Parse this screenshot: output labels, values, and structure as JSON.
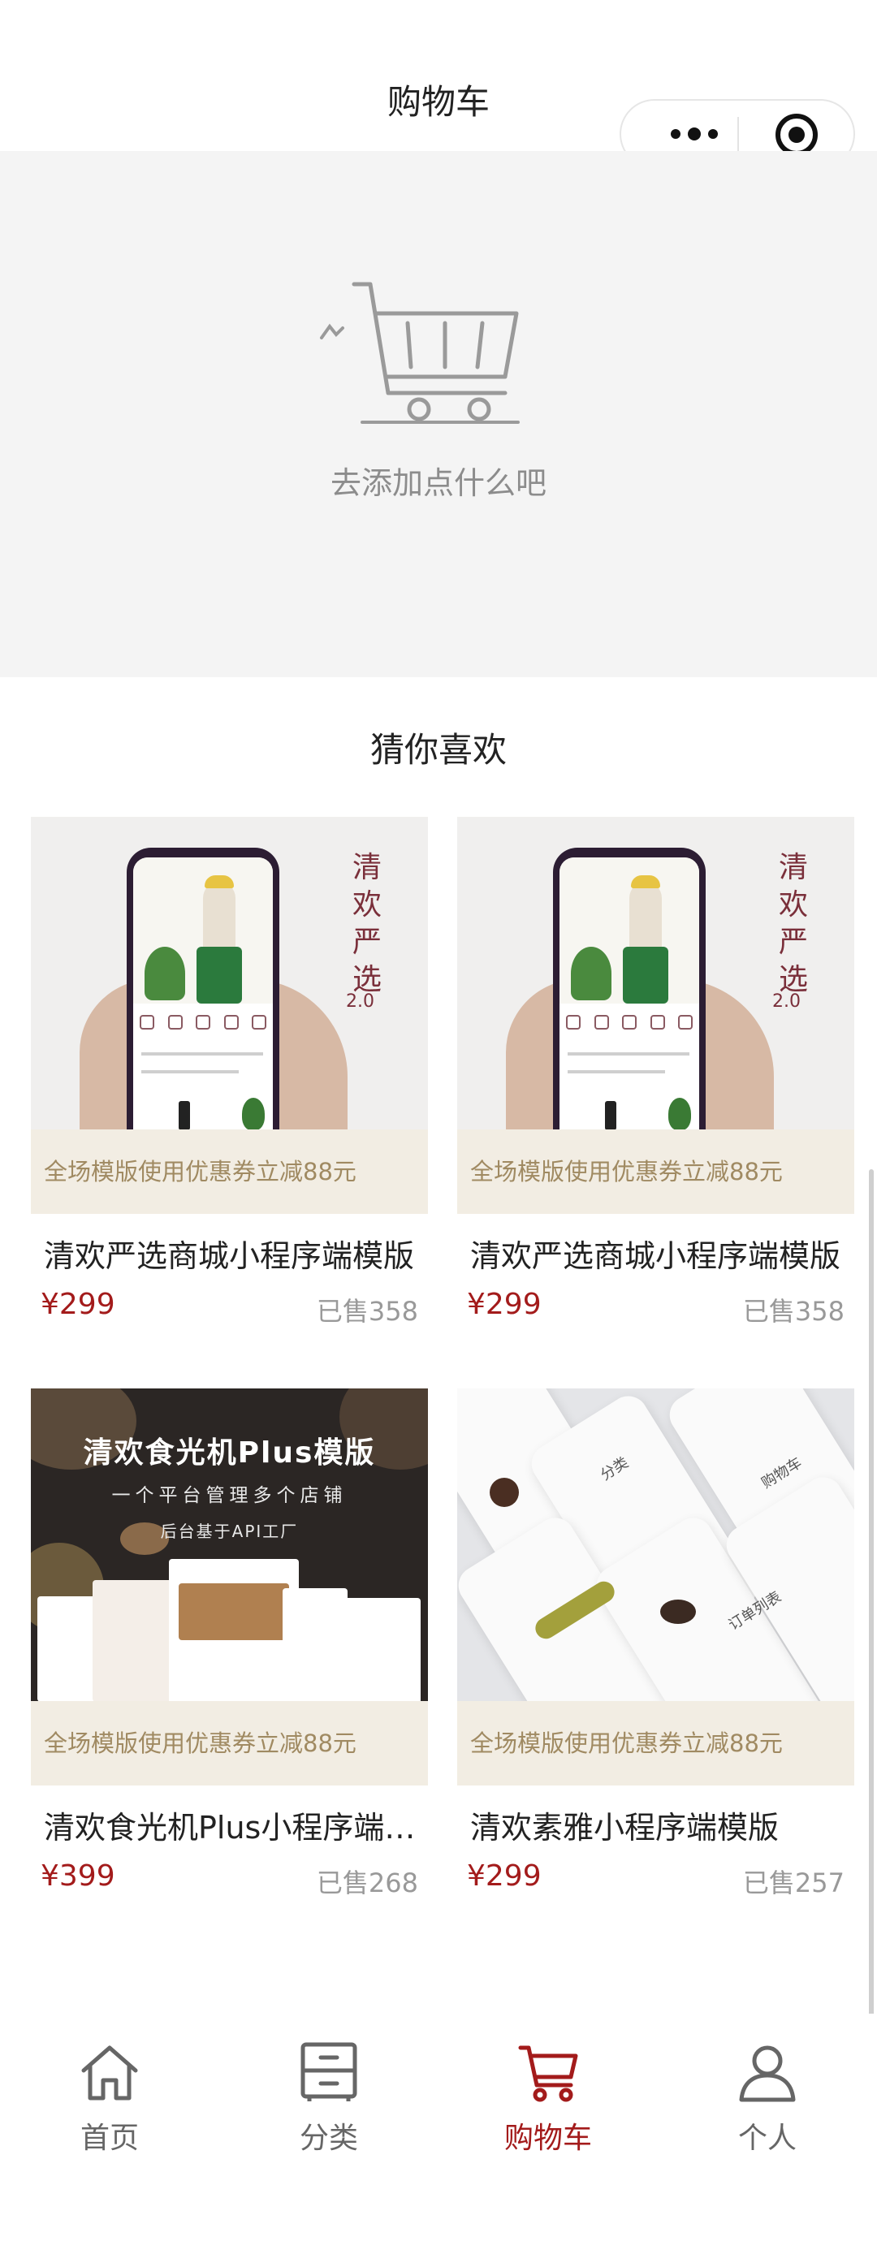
{
  "header": {
    "title": "购物车"
  },
  "capsule": {
    "more_icon": "more-dots-icon",
    "close_icon": "target-circle-icon"
  },
  "empty_cart": {
    "icon": "empty-cart-icon",
    "text": "去添加点什么吧"
  },
  "recommend": {
    "title": "猜你喜欢",
    "products": [
      {
        "image_title": "清欢严选",
        "image_version": "2.0",
        "coupon": "全场模版使用优惠券立减88元",
        "name": "清欢严选商城小程序端模版",
        "price": "¥299",
        "sold": "已售358"
      },
      {
        "image_title": "清欢严选",
        "image_version": "2.0",
        "coupon": "全场模版使用优惠券立减88元",
        "name": "清欢严选商城小程序端模版",
        "price": "¥299",
        "sold": "已售358"
      },
      {
        "image_title": "清欢食光机Plus模版",
        "image_subtitle": "一个平台管理多个店铺",
        "image_subtitle2": "后台基于API工厂",
        "coupon": "全场模版使用优惠券立减88元",
        "name": "清欢食光机Plus小程序端模版",
        "price": "¥399",
        "sold": "已售268"
      },
      {
        "image_labels": [
          "分类",
          "购物车",
          "订单列表"
        ],
        "coupon": "全场模版使用优惠券立减88元",
        "name": "清欢素雅小程序端模版",
        "price": "¥299",
        "sold": "已售257"
      }
    ]
  },
  "tabbar": {
    "items": [
      {
        "label": "首页",
        "icon": "home-icon",
        "active": false
      },
      {
        "label": "分类",
        "icon": "category-cabinet-icon",
        "active": false
      },
      {
        "label": "购物车",
        "icon": "cart-icon",
        "active": true
      },
      {
        "label": "个人",
        "icon": "person-icon",
        "active": false
      }
    ]
  },
  "colors": {
    "accent": "#a31b1b",
    "coupon_bg": "#f2ede3",
    "coupon_text": "#a08a62",
    "empty_bg": "#f4f4f4"
  }
}
